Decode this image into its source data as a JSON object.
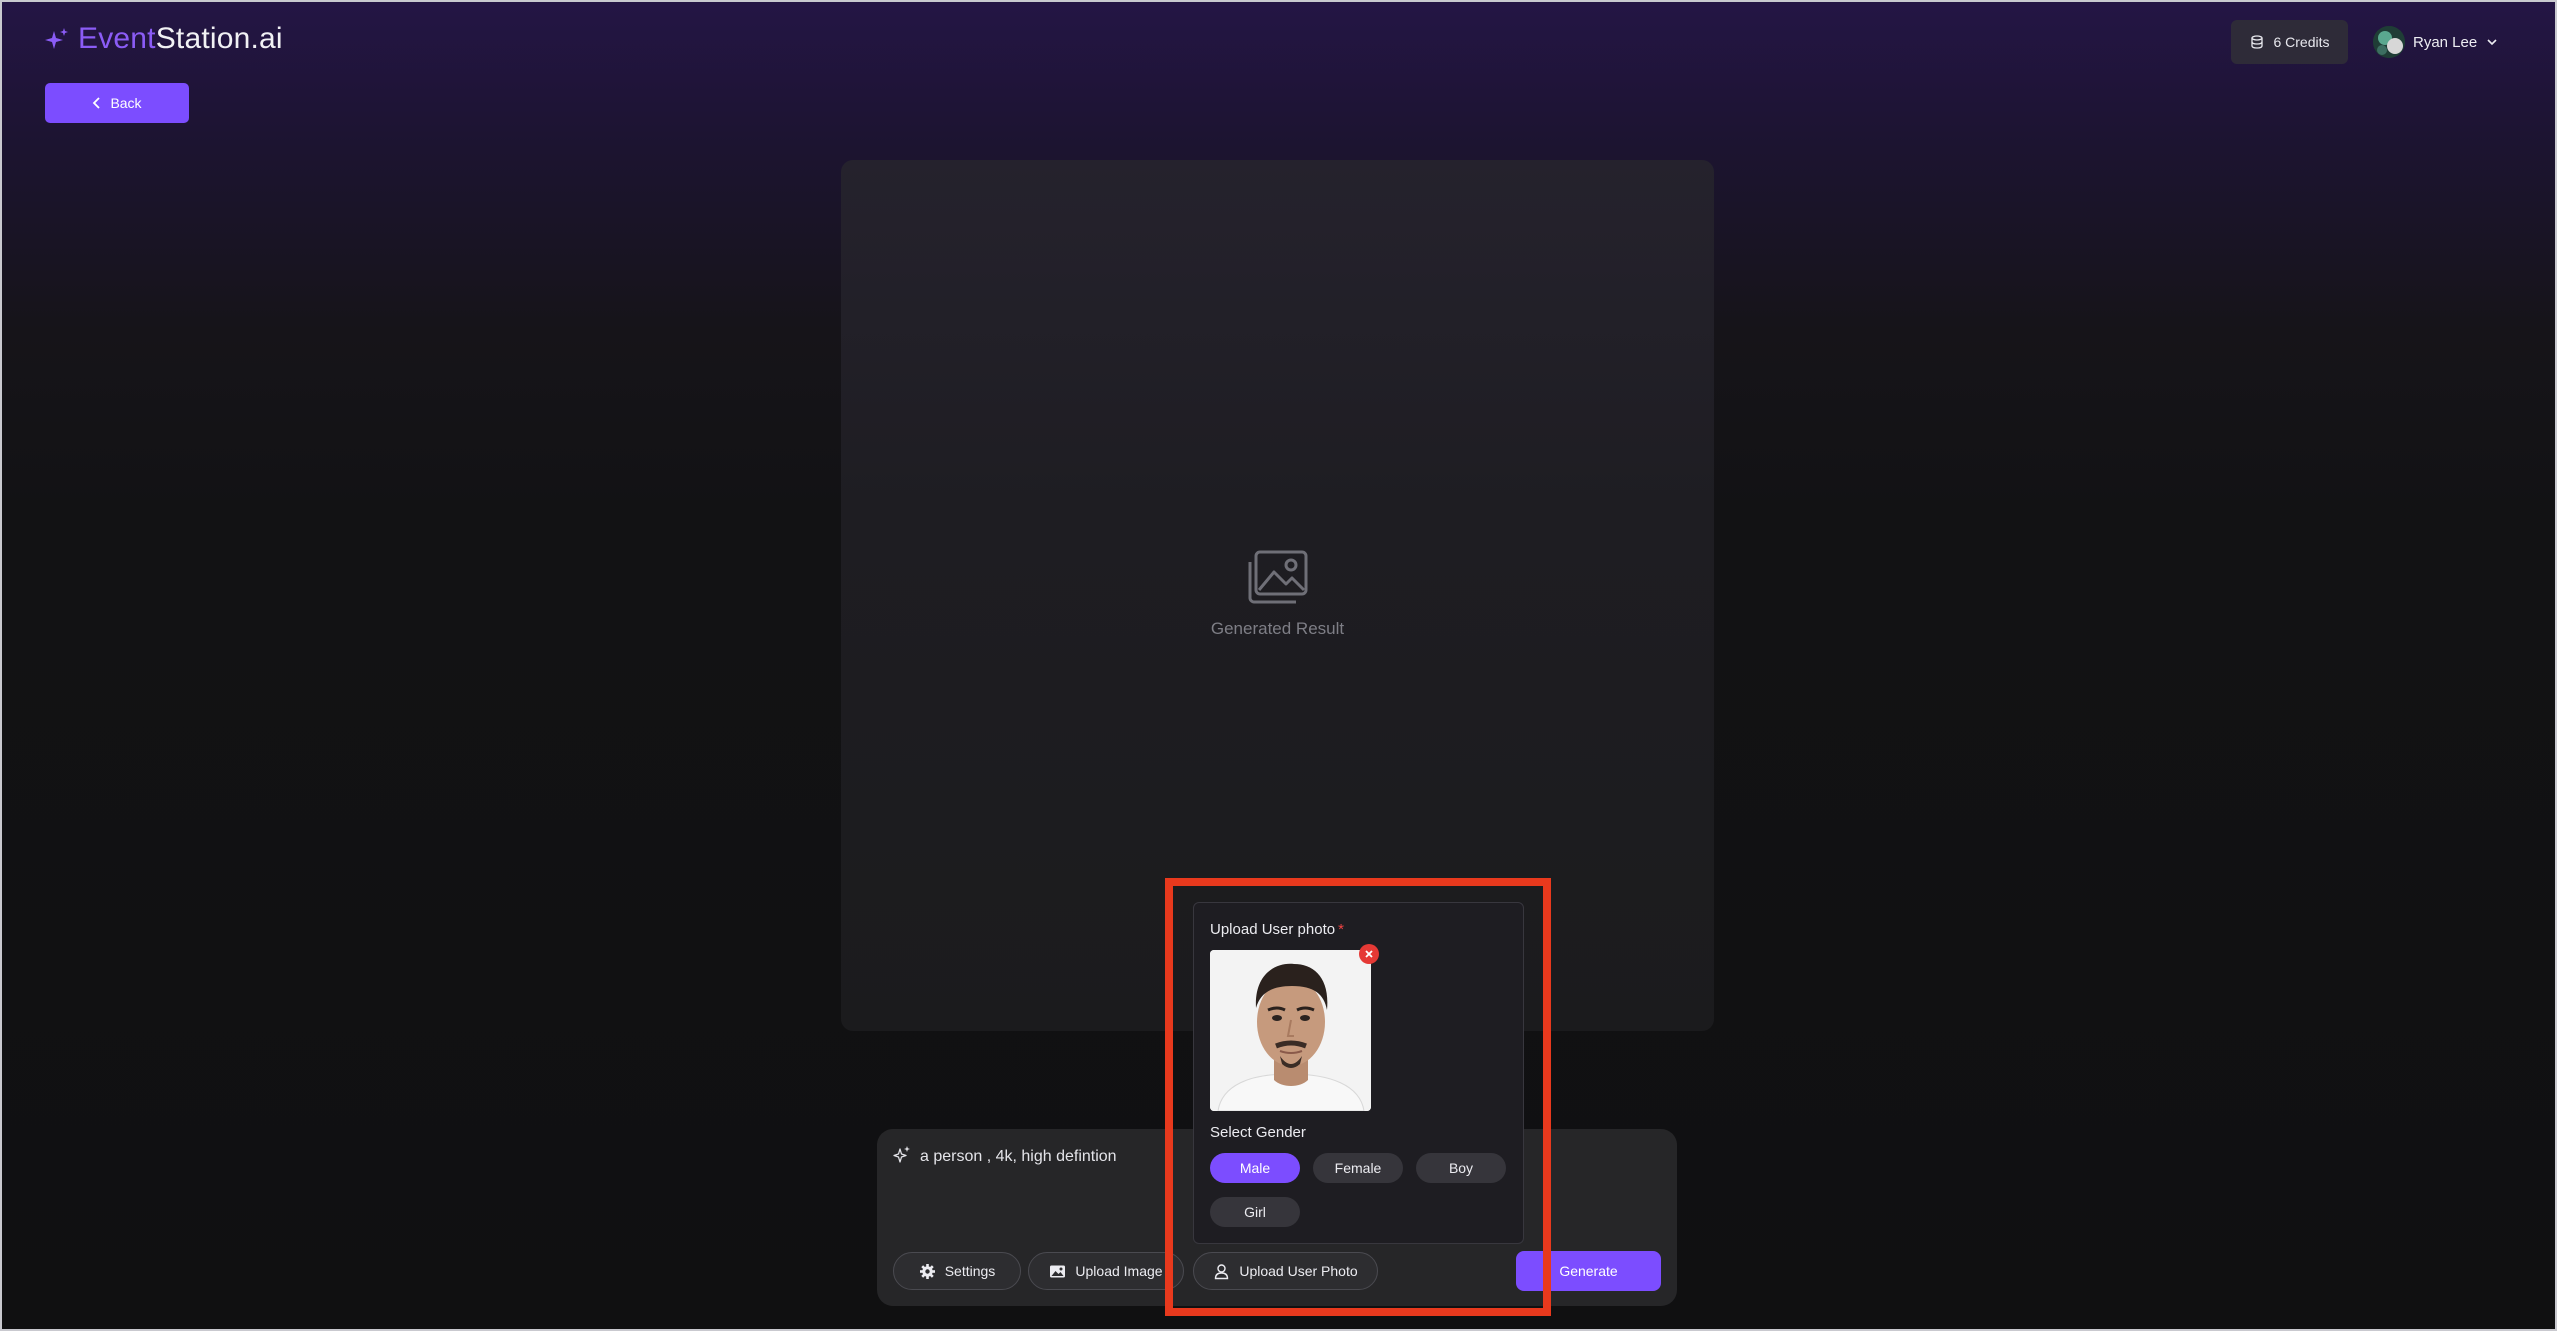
{
  "header": {
    "logo_accent": "Event",
    "logo_main": "Station.ai",
    "back_label": "Back",
    "credits_label": "6 Credits",
    "user_name": "Ryan Lee"
  },
  "result": {
    "placeholder_label": "Generated Result",
    "icon": "image-icon"
  },
  "prompt": {
    "text": "a person , 4k, high defintion",
    "buttons": {
      "settings": "Settings",
      "upload_image": "Upload Image",
      "upload_user_photo": "Upload User Photo",
      "generate": "Generate"
    }
  },
  "popover": {
    "title": "Upload User photo",
    "required_mark": "*",
    "gender_label": "Select Gender",
    "genders": [
      "Male",
      "Female",
      "Boy",
      "Girl"
    ],
    "selected_gender": "Male"
  },
  "colors": {
    "accent": "#7c4dff",
    "highlight": "#e8391d",
    "remove": "#e53935"
  }
}
